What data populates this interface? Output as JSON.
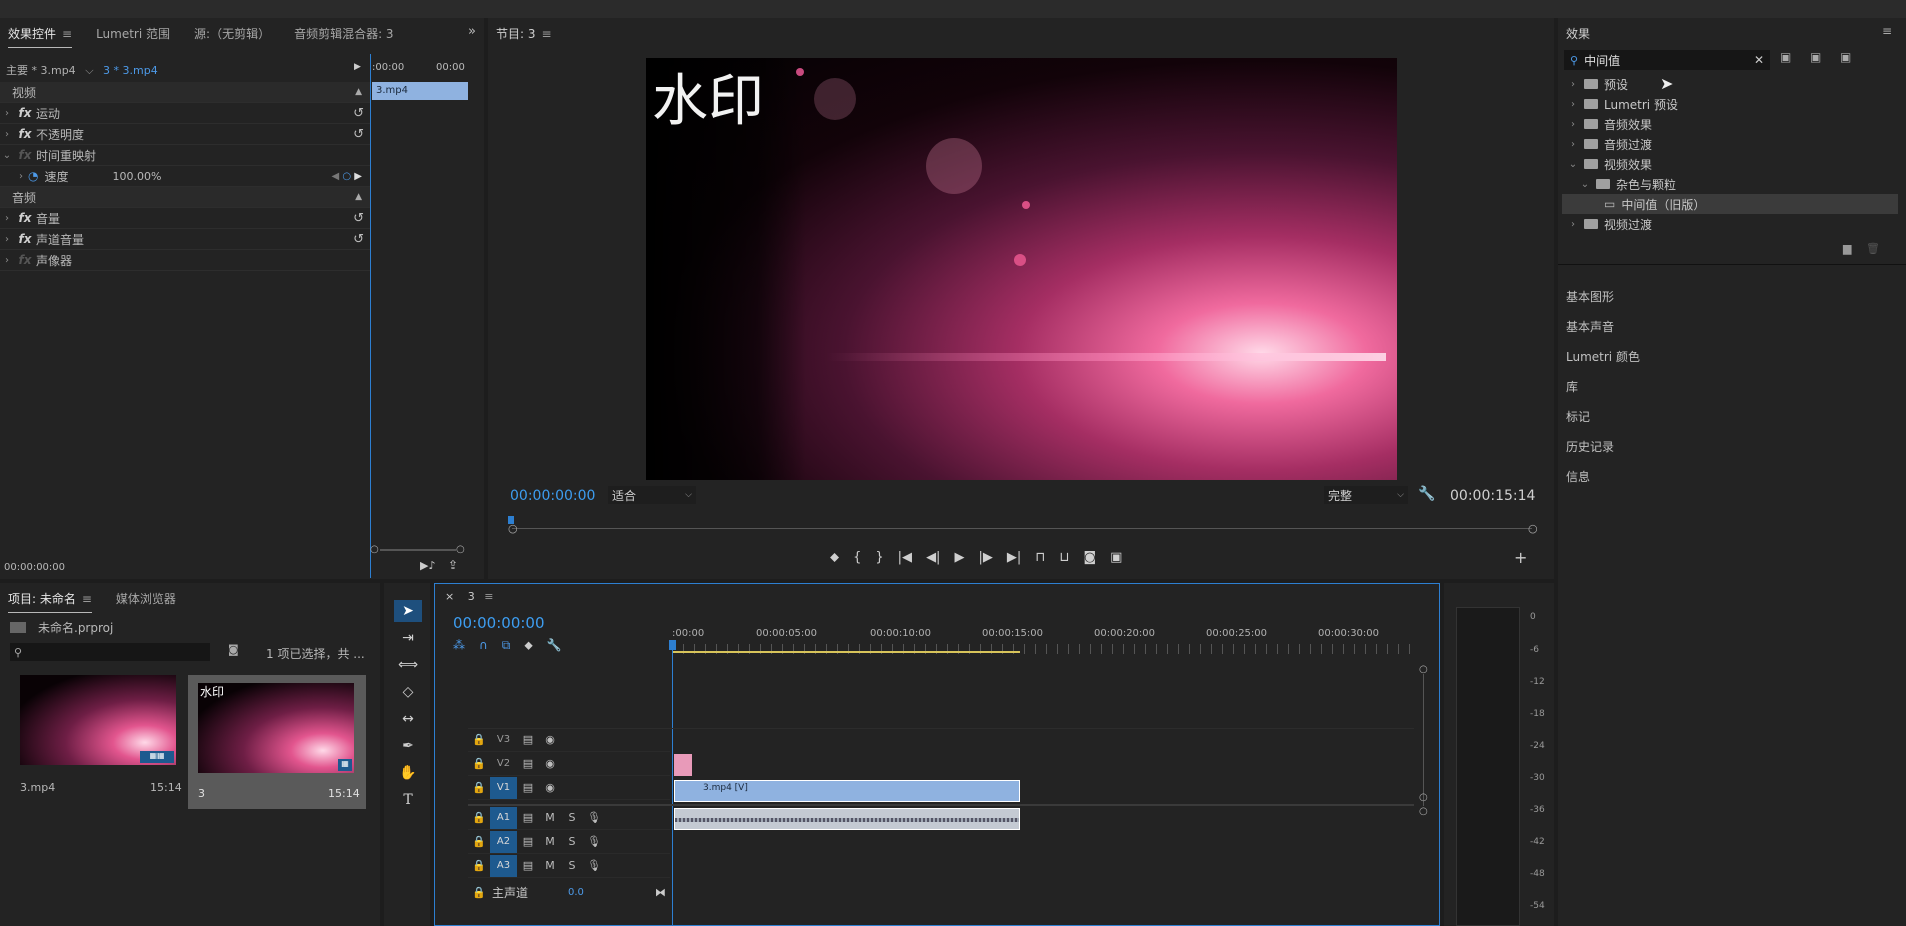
{
  "effect_controls": {
    "tabs": [
      "效果控件",
      "Lumetri 范围",
      "源:（无剪辑）",
      "音频剪辑混合器: 3"
    ],
    "master_label": "主要 * 3.mp4",
    "clip_label": "3 * 3.mp4",
    "ruler_start": ":00:00",
    "ruler_end": "00:00",
    "clip_bar": "3.mp4",
    "video_section": "视频",
    "audio_section": "音频",
    "effects": [
      "运动",
      "不透明度",
      "时间重映射",
      "速度",
      "音量",
      "声道音量",
      "声像器"
    ],
    "speed_value": "100.00%",
    "timecode": "00:00:00:00"
  },
  "program": {
    "title": "节目: 3",
    "watermark": "水印",
    "timecode_left": "00:00:00:00",
    "zoom": "适合",
    "quality": "完整",
    "timecode_right": "00:00:15:14"
  },
  "effects_panel": {
    "title": "效果",
    "search_value": "中间值",
    "tree": [
      "预设",
      "Lumetri 预设",
      "音频效果",
      "音频过渡",
      "视频效果",
      "杂色与颗粒",
      "中间值（旧版）",
      "视频过渡"
    ],
    "sections": [
      "基本图形",
      "基本声音",
      "Lumetri 颜色",
      "库",
      "标记",
      "历史记录",
      "信息"
    ]
  },
  "project": {
    "tabs": [
      "项目: 未命名",
      "媒体浏览器"
    ],
    "filename": "未命名.prproj",
    "selection_text": "1 项已选择，共 ...",
    "items": [
      {
        "name": "3.mp4",
        "duration": "15:14",
        "overlay": ""
      },
      {
        "name": "3",
        "duration": "15:14",
        "overlay": "水印"
      }
    ]
  },
  "timeline": {
    "tab": "3",
    "timecode": "00:00:00:00",
    "ruler": [
      ":00:00",
      "00:00:05:00",
      "00:00:10:00",
      "00:00:15:00",
      "00:00:20:00",
      "00:00:25:00",
      "00:00:30:00"
    ],
    "video_tracks": [
      "V3",
      "V2",
      "V1"
    ],
    "audio_tracks": [
      "A1",
      "A2",
      "A3"
    ],
    "mute": "M",
    "solo": "S",
    "master_label": "主声道",
    "master_value": "0.0",
    "video_clip": "3.mp4 [V]"
  },
  "meter": {
    "scale": [
      "0",
      "-6",
      "-12",
      "-18",
      "-24",
      "-30",
      "-36",
      "-42",
      "-48",
      "-54"
    ]
  },
  "colors": {
    "accent": "#3d9df0",
    "clip_video": "#8fb2e0",
    "clip_pink": "#e89ab9",
    "track_blue": "#1e5a8f"
  }
}
